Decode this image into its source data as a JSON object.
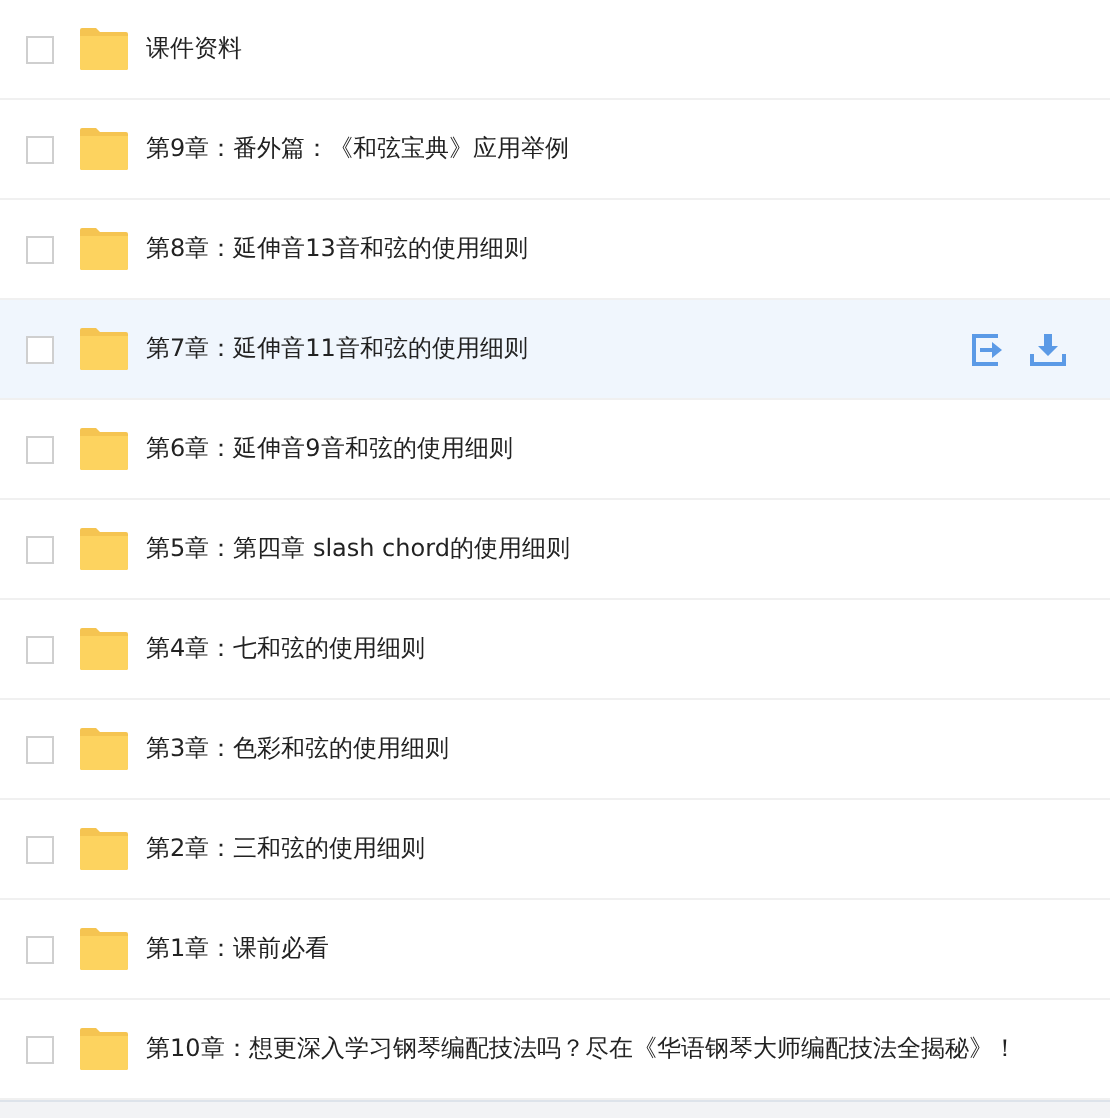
{
  "rows": [
    {
      "name": "课件资料",
      "checked": false,
      "highlighted": false
    },
    {
      "name": "第9章：番外篇：《和弦宝典》应用举例",
      "checked": false,
      "highlighted": false
    },
    {
      "name": "第8章：延伸音13音和弦的使用细则",
      "checked": false,
      "highlighted": false
    },
    {
      "name": "第7章：延伸音11音和弦的使用细则",
      "checked": false,
      "highlighted": true
    },
    {
      "name": "第6章：延伸音9音和弦的使用细则",
      "checked": false,
      "highlighted": false
    },
    {
      "name": "第5章：第四章 slash chord的使用细则",
      "checked": false,
      "highlighted": false
    },
    {
      "name": "第4章：七和弦的使用细则",
      "checked": false,
      "highlighted": false
    },
    {
      "name": "第3章：色彩和弦的使用细则",
      "checked": false,
      "highlighted": false
    },
    {
      "name": "第2章：三和弦的使用细则",
      "checked": false,
      "highlighted": false
    },
    {
      "name": "第1章：课前必看",
      "checked": false,
      "highlighted": false
    },
    {
      "name": "第10章：想更深入学习钢琴编配技法吗？尽在《华语钢琴大师编配技法全揭秘》！",
      "checked": false,
      "highlighted": false
    }
  ]
}
